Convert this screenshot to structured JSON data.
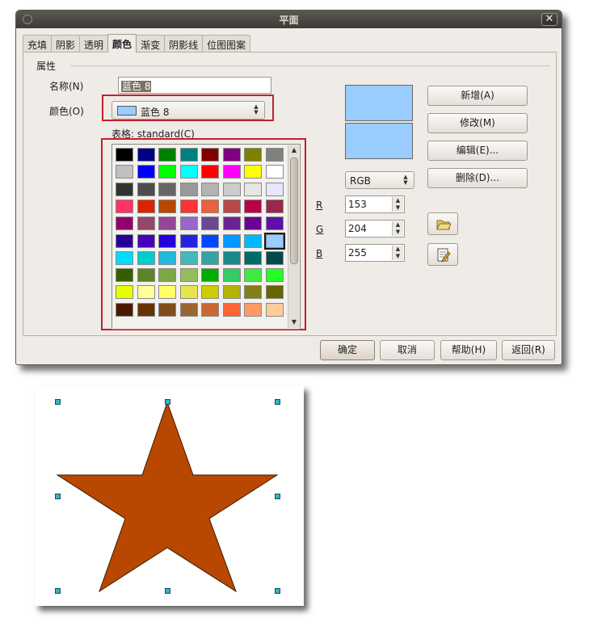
{
  "dialog": {
    "title": "平面",
    "close_glyph": "✕",
    "tabs": [
      {
        "label": "充填",
        "active": false
      },
      {
        "label": "阴影",
        "active": false
      },
      {
        "label": "透明",
        "active": false
      },
      {
        "label": "颜色",
        "active": true
      },
      {
        "label": "渐变",
        "active": false
      },
      {
        "label": "阴影线",
        "active": false
      },
      {
        "label": "位图图案",
        "active": false
      }
    ],
    "section_label": "属性",
    "name_label": "名称(N)",
    "name_value": "蓝色 8",
    "color_label": "颜色(O)",
    "color_value": "蓝色 8",
    "table_label": "表格: standard(C)",
    "selected_color": "#99ccff",
    "palette": [
      [
        "#000000",
        "#000080",
        "#008000",
        "#008080",
        "#800000",
        "#800080",
        "#808000",
        "#808080"
      ],
      [
        "#c0c0c0",
        "#0000ff",
        "#00ff00",
        "#00ffff",
        "#ff0000",
        "#ff00ff",
        "#ffff00",
        "#ffffff"
      ],
      [
        "#333333",
        "#4d4d4d",
        "#666666",
        "#999999",
        "#b3b3b3",
        "#cccccc",
        "#e6e6e6",
        "#e6e6ff"
      ],
      [
        "#ff3366",
        "#dc2300",
        "#b84700",
        "#ff3333",
        "#eb613d",
        "#b84747",
        "#b80047",
        "#99284c"
      ],
      [
        "#94006b",
        "#94476b",
        "#944794",
        "#9966cc",
        "#6b4794",
        "#6b2394",
        "#6b0094",
        "#5e11a6"
      ],
      [
        "#280099",
        "#4700b8",
        "#2300dc",
        "#2323dc",
        "#0047ff",
        "#0099ff",
        "#00b8ff",
        "#99ccff"
      ],
      [
        "#00dcff",
        "#00cccc",
        "#23b8dc",
        "#47b8b8",
        "#33a3a3",
        "#198a8a",
        "#006b6b",
        "#004a4a"
      ],
      [
        "#355e00",
        "#5c8526",
        "#7da647",
        "#94bd5e",
        "#00ae00",
        "#33cc66",
        "#3deb3d",
        "#23ff23"
      ],
      [
        "#e6ff00",
        "#ffff99",
        "#ffff66",
        "#e6e64c",
        "#cccc00",
        "#b3b300",
        "#808019",
        "#666600"
      ],
      [
        "#4c1900",
        "#663300",
        "#804c19",
        "#996633",
        "#cc6633",
        "#ff6633",
        "#ff9966",
        "#ffcc99"
      ]
    ],
    "buttons": {
      "add": "新增(A)",
      "modify": "修改(M)",
      "edit": "编辑(E)...",
      "delete": "删除(D)...",
      "ok": "确定",
      "cancel": "取消",
      "help": "帮助(H)",
      "back": "返回(R)"
    },
    "model_value": "RGB",
    "r_label": "R",
    "g_label": "G",
    "b_label": "B",
    "r_value": "153",
    "g_value": "204",
    "b_value": "255"
  },
  "canvas": {
    "shape": "star",
    "fill_color": "#b84700",
    "handle_color": "#2fb6c7"
  }
}
